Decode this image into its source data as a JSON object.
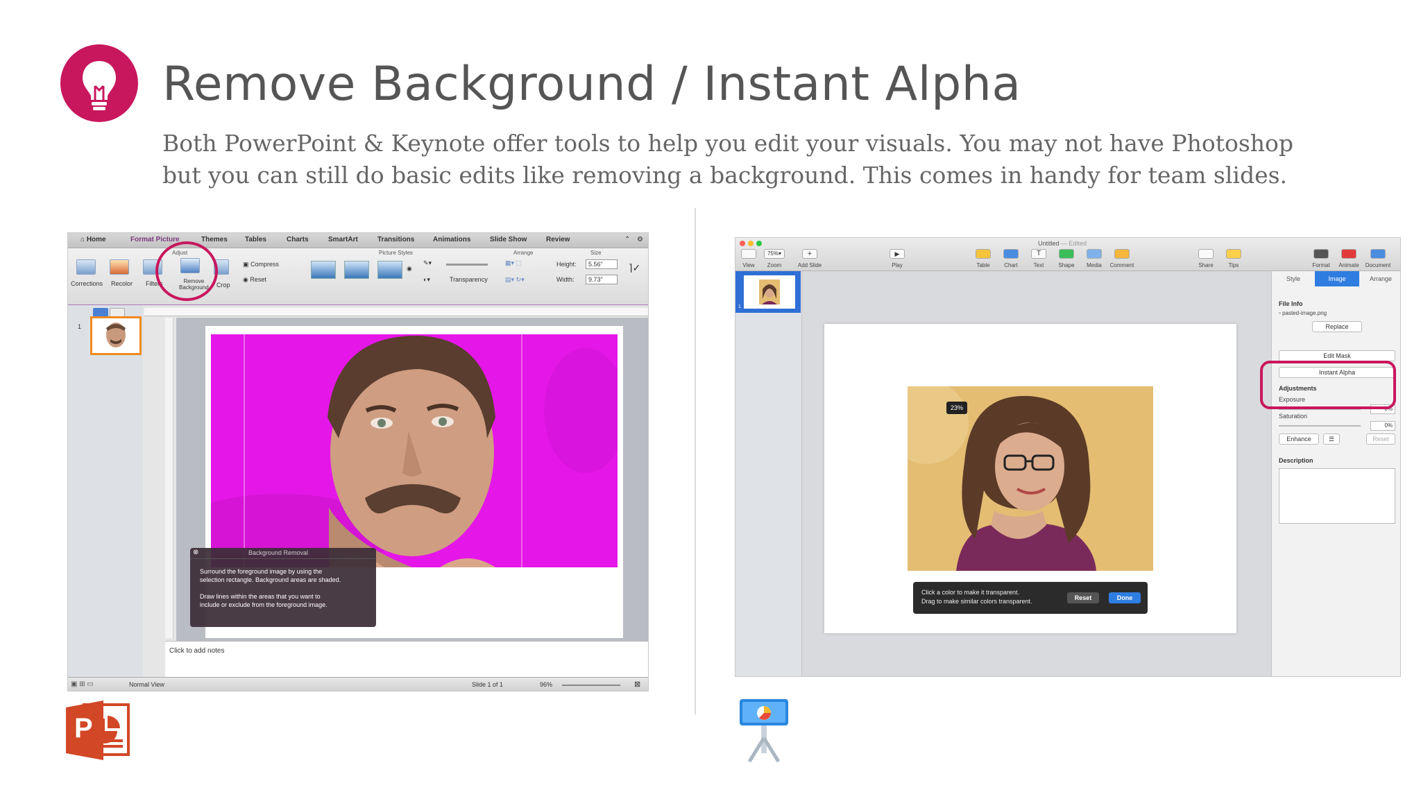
{
  "header": {
    "title": "Remove Background / Instant Alpha",
    "subtitle_line1": "Both PowerPoint & Keynote offer tools to help you edit your visuals. You may not have Photoshop",
    "subtitle_line2": "but you can still do basic edits like removing a background. This comes in handy for team slides.",
    "accent_color": "#c8175d",
    "icon": "lightbulb-icon"
  },
  "powerpoint": {
    "tabs": [
      "Home",
      "Format Picture",
      "Themes",
      "Tables",
      "Charts",
      "SmartArt",
      "Transitions",
      "Animations",
      "Slide Show",
      "Review"
    ],
    "active_tab": "Format Picture",
    "groups": {
      "adjust": "Adjust",
      "picture_styles": "Picture Styles",
      "arrange": "Arrange",
      "size": "Size"
    },
    "buttons": {
      "corrections": "Corrections",
      "recolor": "Recolor",
      "filters": "Filters",
      "remove_background_1": "Remove",
      "remove_background_2": "Background",
      "crop": "Crop",
      "compress": "Compress",
      "reset": "Reset",
      "transparency": "Transparency"
    },
    "size": {
      "height_label": "Height:",
      "height_value": "5.56\"",
      "width_label": "Width:",
      "width_value": "9.73\""
    },
    "thumbnail_number": "1",
    "dialog": {
      "title": "Background Removal",
      "para1_line1": "Surround the foreground image by using the",
      "para1_line2": "selection rectangle. Background areas are shaded.",
      "para2_line1": "Draw lines within the areas that you want to",
      "para2_line2": "include or exclude from the foreground image."
    },
    "notes_placeholder": "Click to add notes",
    "status": {
      "view": "Normal View",
      "slide": "Slide 1 of 1",
      "zoom": "96%"
    }
  },
  "keynote": {
    "window_title": "Untitled",
    "window_status": "— Edited",
    "toolbar": {
      "view": "View",
      "zoom_value": "75%",
      "zoom": "Zoom",
      "add_slide": "Add Slide",
      "play": "Play",
      "table": "Table",
      "chart": "Chart",
      "text": "Text",
      "shape": "Shape",
      "media": "Media",
      "comment": "Comment",
      "share": "Share",
      "tips": "Tips",
      "format": "Format",
      "animate": "Animate",
      "document": "Document"
    },
    "panel": {
      "tabs": [
        "Style",
        "Image",
        "Arrange"
      ],
      "active_tab": "Image",
      "file_info": "File Info",
      "file_name": "pasted-image.png",
      "replace": "Replace",
      "edit_mask": "Edit Mask",
      "instant_alpha": "Instant Alpha",
      "adjustments": "Adjustments",
      "exposure": "Exposure",
      "exposure_value": "0%",
      "saturation": "Saturation",
      "saturation_value": "0%",
      "enhance": "Enhance",
      "reset": "Reset",
      "description": "Description"
    },
    "slide_number": "1",
    "alpha_percent": "23%",
    "instant_alpha_bar": {
      "line1": "Click a color to make it transparent.",
      "line2": "Drag to make similar colors transparent.",
      "reset": "Reset",
      "done": "Done"
    }
  },
  "logos": {
    "powerpoint_letter": "P"
  }
}
